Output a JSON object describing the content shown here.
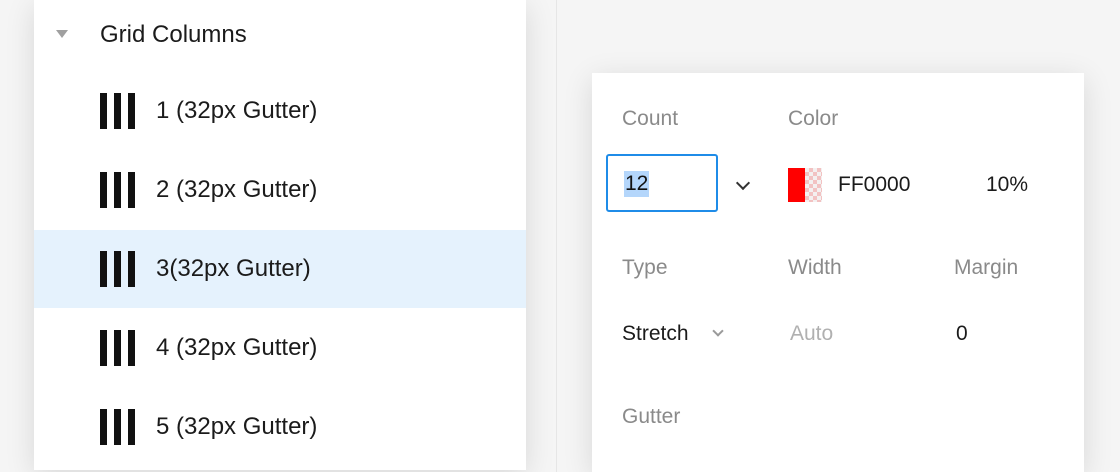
{
  "styles_panel": {
    "group_title": "Grid Columns",
    "items": [
      {
        "label": "1 (32px Gutter)",
        "selected": false
      },
      {
        "label": "2 (32px Gutter)",
        "selected": false
      },
      {
        "label": "3(32px Gutter)",
        "selected": true
      },
      {
        "label": "4 (32px Gutter)",
        "selected": false
      },
      {
        "label": "5 (32px Gutter)",
        "selected": false
      }
    ]
  },
  "grid_settings": {
    "count_label": "Count",
    "count_value": "12",
    "color_label": "Color",
    "color_hex": "FF0000",
    "color_swatch": "#ff0000",
    "opacity": "10%",
    "type_label": "Type",
    "type_value": "Stretch",
    "width_label": "Width",
    "width_value": "Auto",
    "margin_label": "Margin",
    "margin_value": "0",
    "gutter_label": "Gutter"
  },
  "colors": {
    "selection_bg": "#e5f2fd",
    "focus_border": "#1f8ce8",
    "text_selection": "#b4d6fb"
  }
}
